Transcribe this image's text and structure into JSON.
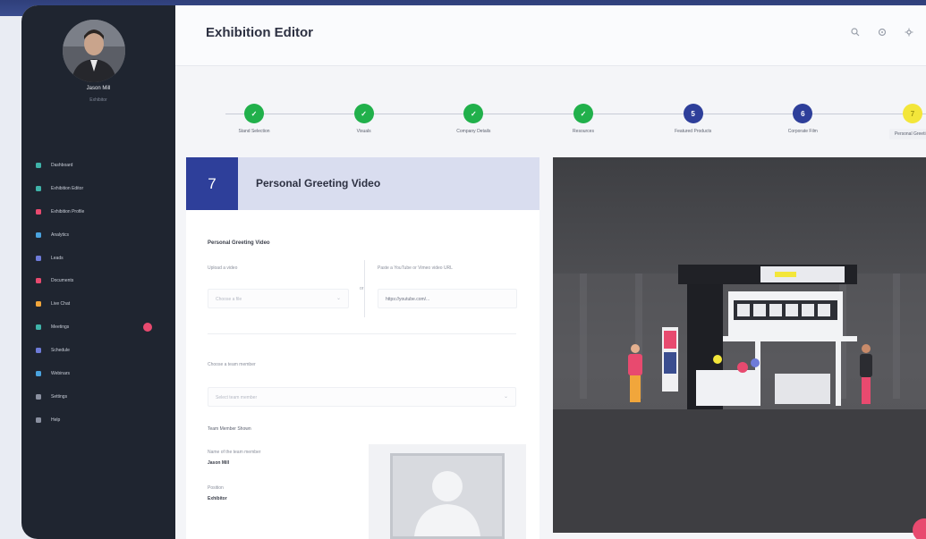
{
  "app": {
    "title": "Exhibition Editor"
  },
  "user": {
    "name": "Jason Mill",
    "role": "Exhibitor"
  },
  "sidebar": {
    "items": [
      {
        "label": "Dashboard",
        "icon": "grid-icon",
        "color": "#3fb3a9"
      },
      {
        "label": "Exhibition Editor",
        "icon": "edit-icon",
        "color": "#3fb3a9"
      },
      {
        "label": "Exhibition Profile",
        "icon": "id-card-icon",
        "color": "#e84a6f"
      },
      {
        "label": "Analytics",
        "icon": "chart-icon",
        "color": "#4aa3df"
      },
      {
        "label": "Leads",
        "icon": "users-icon",
        "color": "#6e7bd9"
      },
      {
        "label": "Documents",
        "icon": "folder-icon",
        "color": "#e84a6f"
      },
      {
        "label": "Live Chat",
        "icon": "chat-icon",
        "color": "#f1a63b"
      },
      {
        "label": "Meetings",
        "icon": "calendar-icon",
        "color": "#3fb3a9",
        "badge": true
      },
      {
        "label": "Schedule",
        "icon": "clock-icon",
        "color": "#6e7bd9"
      },
      {
        "label": "Webinars",
        "icon": "video-icon",
        "color": "#4aa3df"
      },
      {
        "label": "Settings",
        "icon": "gear-icon",
        "color": "#8a90a0"
      },
      {
        "label": "Help",
        "icon": "help-icon",
        "color": "#8a90a0"
      }
    ]
  },
  "header": {
    "icons": [
      "search-icon",
      "bell-icon",
      "settings-icon"
    ]
  },
  "stepper": {
    "steps": [
      {
        "label": "Stand Selection",
        "mark": "✓",
        "state": "done",
        "color": "#21b04b"
      },
      {
        "label": "Visuals",
        "mark": "✓",
        "state": "done",
        "color": "#21b04b"
      },
      {
        "label": "Company Details",
        "mark": "✓",
        "state": "done",
        "color": "#21b04b"
      },
      {
        "label": "Resources",
        "mark": "✓",
        "state": "done",
        "color": "#21b04b"
      },
      {
        "label": "Featured Products",
        "mark": "5",
        "state": "pending",
        "color": "#2e3f9a"
      },
      {
        "label": "Corporate Film",
        "mark": "6",
        "state": "pending",
        "color": "#2e3f9a"
      },
      {
        "label": "Personal Greeting",
        "mark": "7",
        "state": "active",
        "color": "#f3e63a"
      }
    ]
  },
  "section": {
    "number": "7",
    "title": "Personal Greeting Video"
  },
  "form": {
    "subtitle": "Personal Greeting Video",
    "upload_label": "Upload a video",
    "upload_placeholder": "Choose a file",
    "or_text": "or",
    "link_label": "Paste a YouTube or Vimeo video URL",
    "link_placeholder": "https://youtube.com/...",
    "select_label": "Choose a team member",
    "select_placeholder": "Select team member",
    "member_title": "Team Member Shown",
    "name_label": "Name of the team member",
    "name_value": "Jason Mill",
    "role_label": "Position",
    "role_value": "Exhibitor"
  },
  "preview": {
    "icon": "booth-preview"
  }
}
